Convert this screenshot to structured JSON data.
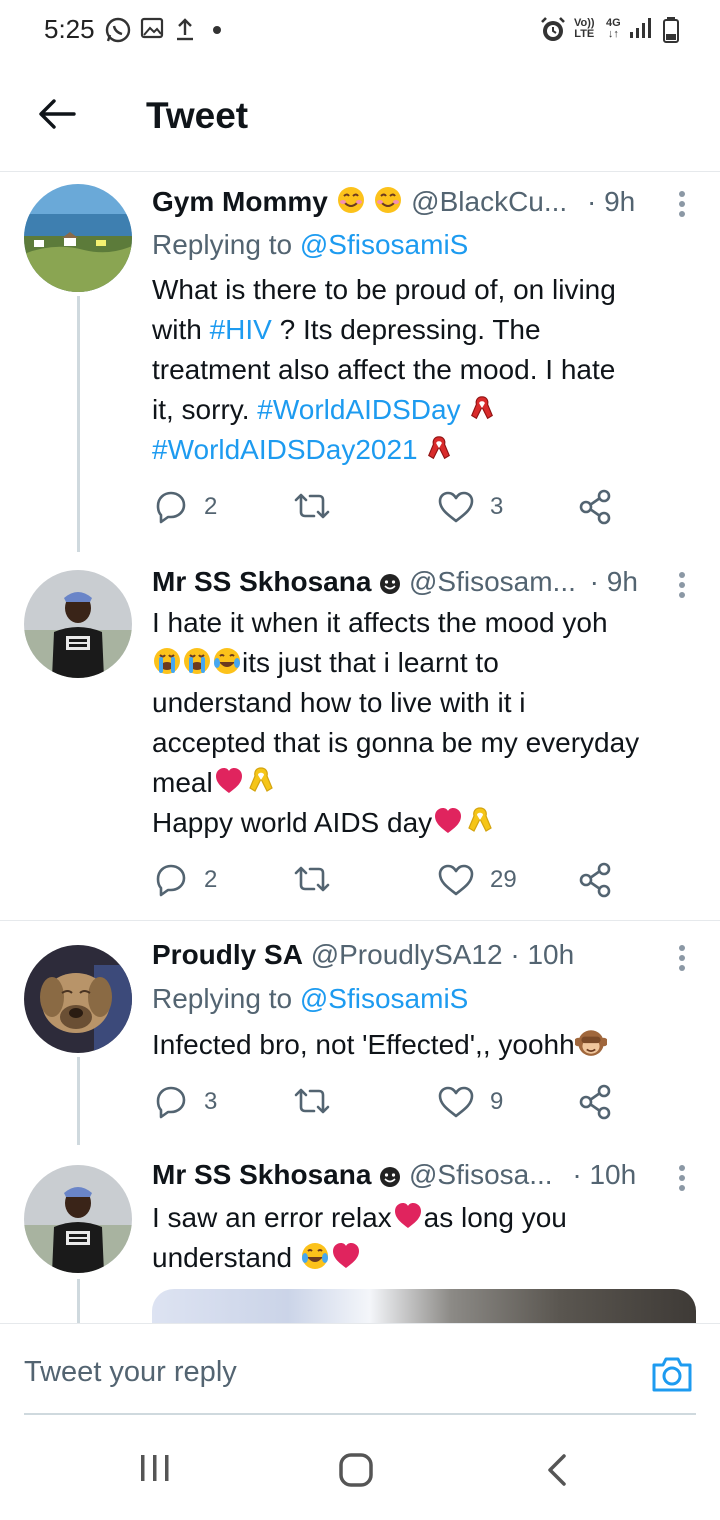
{
  "status_bar": {
    "time": "5:25",
    "volte_top": "Vo))",
    "volte_bottom": "LTE",
    "network": "4G"
  },
  "header": {
    "title": "Tweet",
    "back_icon": "arrow-left-icon"
  },
  "tweets": [
    {
      "name": "Gym Mommy",
      "name_emojis": [
        "smiling-face-icon",
        "blushing-face-icon"
      ],
      "handle": "@BlackCu...",
      "dot": "·",
      "time": "9h",
      "replying_prefix": "Replying to ",
      "replying_to": "@SfisosamiS",
      "body": {
        "line1": "What is there to be proud of, on living",
        "line2_a": "with ",
        "line2_tag": "#HIV",
        "line2_b": "  ? Its depressing. The",
        "line3": "treatment also affect the mood. I hate",
        "line4_a": "it, sorry. ",
        "line4_tag": "#WorldAIDSDay",
        "line5_tag": "#WorldAIDSDay2021"
      },
      "replies": "2",
      "likes": "3"
    },
    {
      "name": "Mr SS Skhosana",
      "handle": "@Sfisosam...",
      "dot": "·",
      "time": "9h",
      "body": {
        "line1": "I hate it when it affects the mood yoh",
        "line2": "its just that i learnt to",
        "line3": "understand how to live with it i",
        "line4": "accepted that is gonna be my everyday",
        "line5": "meal",
        "line6": "Happy world AIDS day"
      },
      "replies": "2",
      "likes": "29"
    },
    {
      "name": "Proudly SA",
      "handle": "@ProudlySA12",
      "dot": "·",
      "time": "10h",
      "replying_prefix": "Replying to ",
      "replying_to": "@SfisosamiS",
      "body": {
        "line1": "Infected bro, not 'Effected',, yoohh"
      },
      "replies": "3",
      "likes": "9"
    },
    {
      "name": "Mr SS Skhosana",
      "handle": "@Sfisosa...",
      "dot": "·",
      "time": "10h",
      "body": {
        "line1": "I saw an error relax",
        "line1_b": "as long you",
        "line2": "understand "
      }
    }
  ],
  "reply_bar": {
    "placeholder": "Tweet your reply",
    "camera_icon": "camera-icon"
  },
  "nav_bar": {
    "recents_icon": "recent-apps-icon",
    "home_icon": "home-icon",
    "back_icon": "back-icon"
  },
  "colors": {
    "accent": "#1d9bf0",
    "secondary_text": "#536471",
    "primary_text": "#0f1419",
    "heart": "#e0245e"
  }
}
